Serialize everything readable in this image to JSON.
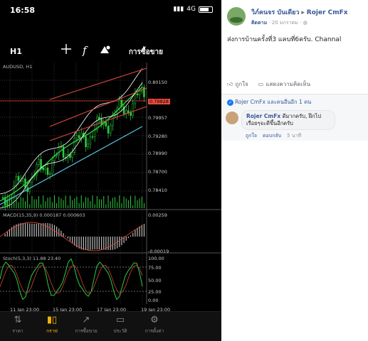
{
  "status": {
    "time": "16:58",
    "network": "4G"
  },
  "toolbar": {
    "timeframe": "H1",
    "crosshair_icon": "crosshair-icon",
    "function_icon": "f",
    "objects_icon": "objects-icon",
    "trade_label": "การซื้อขาย"
  },
  "chart": {
    "symbol_label": "AUDUSD, H1",
    "macd_label": "MACD(15,35,9) 0.000187 0.000603",
    "stoch_label": "Stoch(5,3,3) 11.88 23.40",
    "price_ticks": [
      "0.80150",
      "0.79957",
      "0.79280",
      "0.78990",
      "0.78700",
      "0.78410"
    ],
    "current_price": "0.79828",
    "macd_ticks": [
      "0.00259",
      "-0.00019"
    ],
    "stoch_ticks": [
      "100.00",
      "75.00",
      "50.00",
      "25.00",
      "0.00"
    ],
    "dates": [
      "11 Jan 23:00",
      "15 Jan 23:00",
      "17 Jan 23:00",
      "19 Jan 23:00"
    ]
  },
  "tabs": [
    {
      "label": "ราคา",
      "icon": "arrows-icon"
    },
    {
      "label": "กราฟ",
      "icon": "candles-icon",
      "active": true
    },
    {
      "label": "การซื้อขาย",
      "icon": "trend-icon"
    },
    {
      "label": "ประวัติ",
      "icon": "inbox-icon"
    },
    {
      "label": "การตั้งค่า",
      "icon": "gear-icon"
    }
  ],
  "post": {
    "author": "วิภ์คนจร บันเดียว",
    "arrow": "▸",
    "group": "Rojer CmFx",
    "follow": "ติดตาม",
    "date": "· 20 มกราคม ·",
    "text": "ส่งการบ้านครั้งที่3 แคบที่6ครับ. Channal",
    "like_label": "ถูกใจ",
    "comment_label": "แสดงความคิดเห็น",
    "likes_text": "Rojer CmFx และคนอื่นอีก 1 คน",
    "comment": {
      "name": "Rojer CmFx",
      "text": "ดีมากครับ, ฝึกไปเรื่อยๆจะดีขึ้นอีกครับ",
      "like": "ถูกใจ",
      "reply": "ตอบกลับ",
      "time": "5 นาที"
    }
  }
}
